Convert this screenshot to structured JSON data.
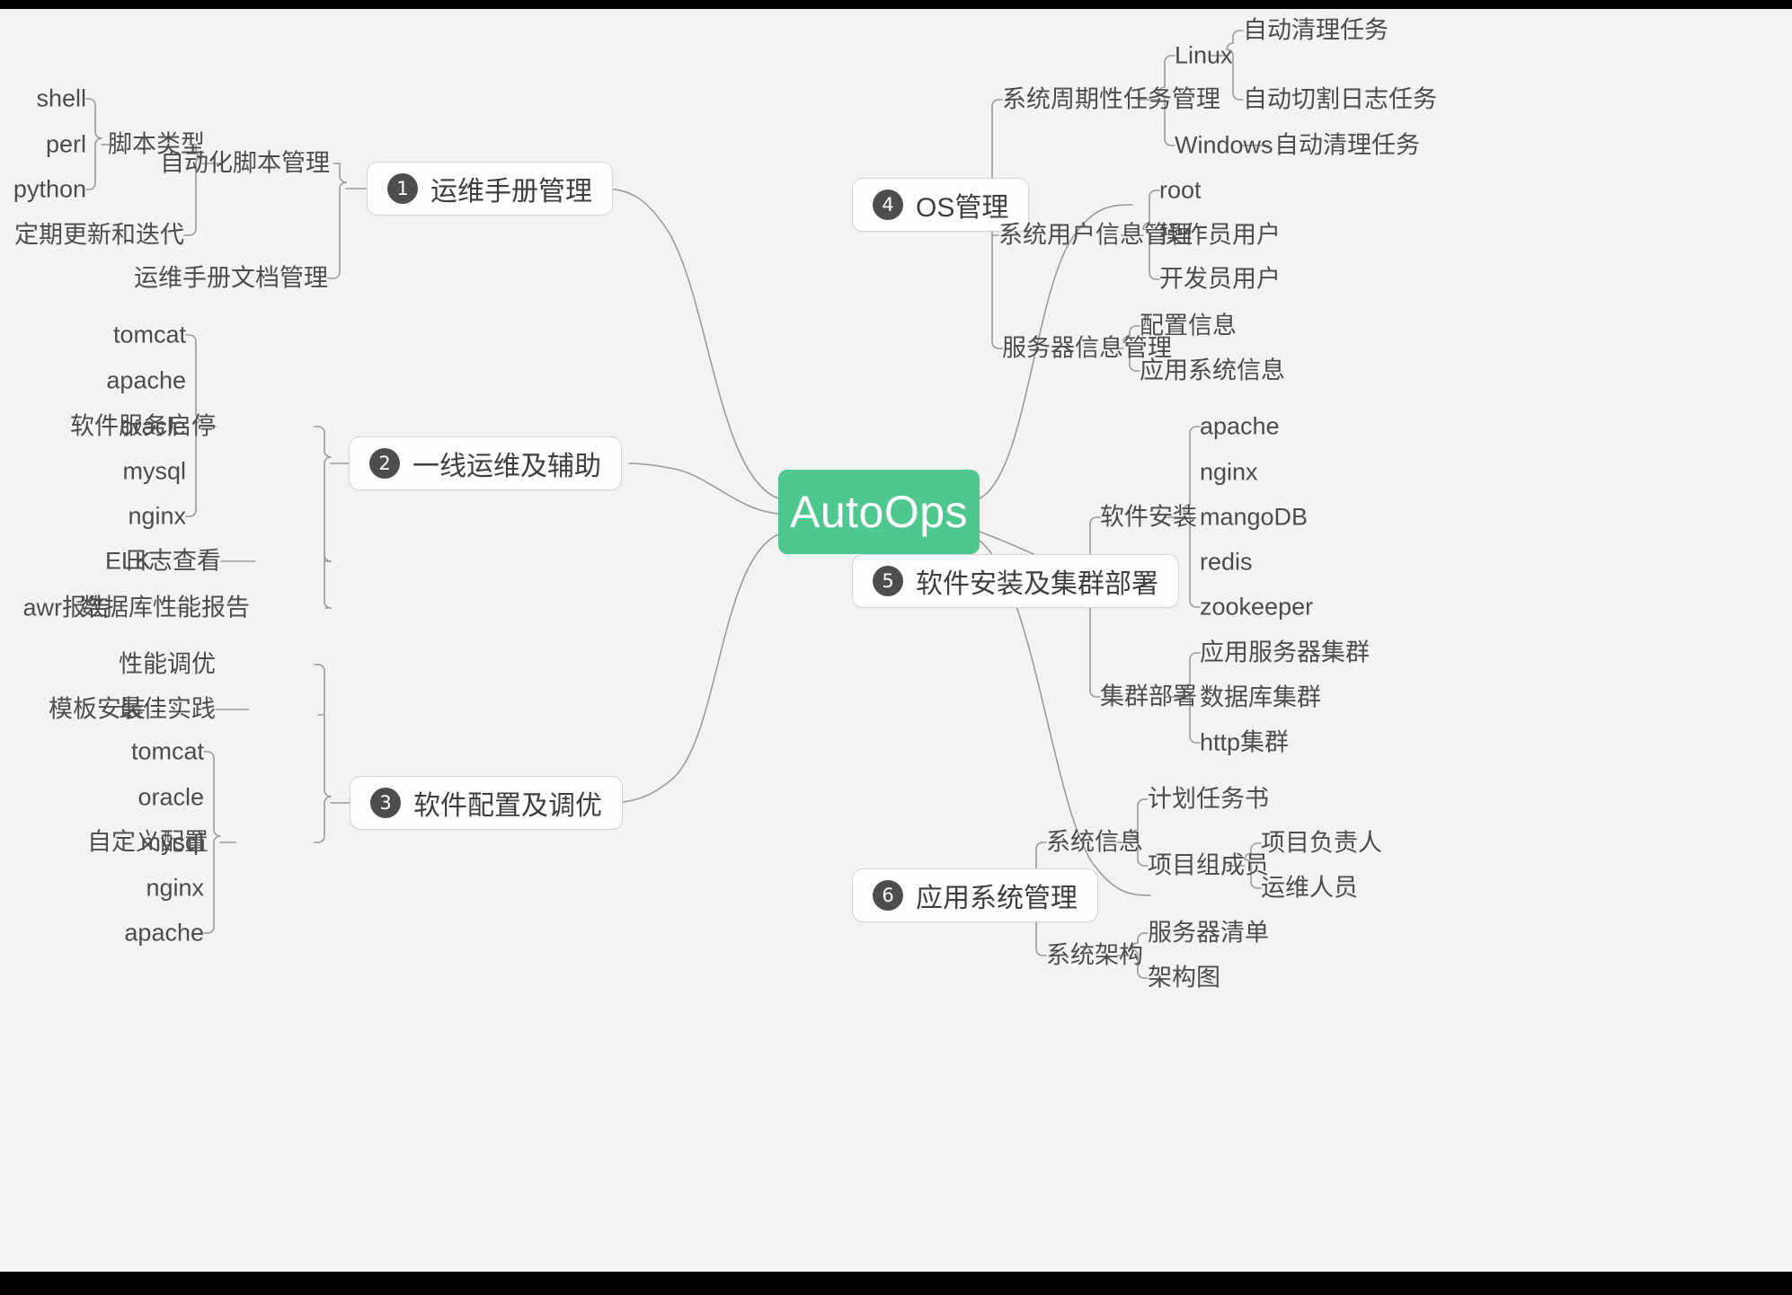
{
  "root": {
    "label": "AutoOps",
    "color": "#4ec88f"
  },
  "theme": {
    "background": "#f2f3f2",
    "line_color": "#9b9b9b",
    "branch_box_bg": "#fdfdfd",
    "badge_color": "#4d4d4d",
    "text_color": "#4c4c4c"
  },
  "branches": [
    {
      "number": "1",
      "label": "运维手册管理",
      "side": "left",
      "children": [
        {
          "label": "自动化脚本管理",
          "children": [
            {
              "label": "脚本类型",
              "children": [
                {
                  "label": "shell"
                },
                {
                  "label": "perl"
                },
                {
                  "label": "python"
                }
              ]
            },
            {
              "label": "定期更新和迭代"
            }
          ]
        },
        {
          "label": "运维手册文档管理"
        }
      ]
    },
    {
      "number": "2",
      "label": "一线运维及辅助",
      "side": "left",
      "children": [
        {
          "label": "软件服务启停",
          "children": [
            {
              "label": "tomcat"
            },
            {
              "label": "apache"
            },
            {
              "label": "oracle"
            },
            {
              "label": "mysql"
            },
            {
              "label": "nginx"
            }
          ]
        },
        {
          "label": "日志查看",
          "children": [
            {
              "label": "ELK"
            }
          ]
        },
        {
          "label": "数据库性能报告",
          "children": [
            {
              "label": "awr报告"
            }
          ]
        }
      ]
    },
    {
      "number": "3",
      "label": "软件配置及调优",
      "side": "left",
      "children": [
        {
          "label": "性能调优"
        },
        {
          "label": "最佳实践",
          "children": [
            {
              "label": "模板安装"
            }
          ]
        },
        {
          "label": "自定义配置",
          "children": [
            {
              "label": "tomcat"
            },
            {
              "label": "oracle"
            },
            {
              "label": "mysql"
            },
            {
              "label": "nginx"
            },
            {
              "label": "apache"
            }
          ]
        }
      ]
    },
    {
      "number": "4",
      "label": "OS管理",
      "side": "right",
      "children": [
        {
          "label": "系统周期性任务管理",
          "children": [
            {
              "label": "Linux",
              "children": [
                {
                  "label": "自动清理任务"
                },
                {
                  "label": "自动切割日志任务"
                }
              ]
            },
            {
              "label": "Windows",
              "children": [
                {
                  "label": "自动清理任务"
                }
              ]
            }
          ]
        },
        {
          "label": "系统用户信息管理",
          "children": [
            {
              "label": "root"
            },
            {
              "label": "操作员用户"
            },
            {
              "label": "开发员用户"
            }
          ]
        },
        {
          "label": "服务器信息管理",
          "children": [
            {
              "label": "配置信息"
            },
            {
              "label": "应用系统信息"
            }
          ]
        }
      ]
    },
    {
      "number": "5",
      "label": "软件安装及集群部署",
      "side": "right",
      "children": [
        {
          "label": "软件安装",
          "children": [
            {
              "label": "apache"
            },
            {
              "label": "nginx"
            },
            {
              "label": "mangoDB"
            },
            {
              "label": "redis"
            },
            {
              "label": "zookeeper"
            }
          ]
        },
        {
          "label": "集群部署",
          "children": [
            {
              "label": "应用服务器集群"
            },
            {
              "label": "数据库集群"
            },
            {
              "label": "http集群"
            }
          ]
        }
      ]
    },
    {
      "number": "6",
      "label": "应用系统管理",
      "side": "right",
      "children": [
        {
          "label": "系统信息",
          "children": [
            {
              "label": "计划任务书"
            },
            {
              "label": "项目组成员",
              "children": [
                {
                  "label": "项目负责人"
                },
                {
                  "label": "运维人员"
                }
              ]
            }
          ]
        },
        {
          "label": "系统架构",
          "children": [
            {
              "label": "服务器清单"
            },
            {
              "label": "架构图"
            }
          ]
        }
      ]
    }
  ]
}
